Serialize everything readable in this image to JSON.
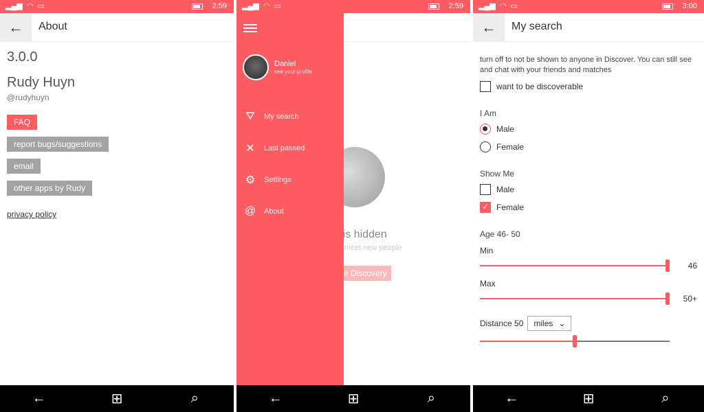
{
  "status": {
    "time_1": "2:59",
    "time_2": "2:59",
    "time_3": "3:00"
  },
  "about": {
    "title": "About",
    "version": "3.0.0",
    "name": "Rudy Huyn",
    "handle": "@rudyhuyn",
    "buttons": {
      "faq": "FAQ",
      "report": "report bugs/suggestions",
      "email": "email",
      "other": "other apps by Rudy"
    },
    "privacy": "privacy policy"
  },
  "drawer": {
    "profile_name": "Daniel",
    "profile_sub": "see your profile",
    "items": [
      {
        "label": "My search",
        "icon": "filter-icon"
      },
      {
        "label": "Last passed",
        "icon": "cross-icon"
      },
      {
        "label": "Settings",
        "icon": "gear-icon"
      },
      {
        "label": "About",
        "icon": "at-icon"
      }
    ],
    "bg_hidden": "rd is hidden",
    "bg_sub": "v to meet new people",
    "bg_button": "e Discovery"
  },
  "search": {
    "title": "My search",
    "intro": "turn off to not be shown to anyone in Discover. You can still see and chat with your friends and matches",
    "discoverable": "want to be discoverable",
    "i_am": "I Am",
    "male": "Male",
    "female": "Female",
    "show_me": "Show Me",
    "age": "Age 46- 50",
    "min": "Min",
    "min_value": "46",
    "max": "Max",
    "max_value": "50+",
    "distance_label": "Distance 50",
    "distance_unit": "miles",
    "discoverable_checked": false,
    "i_am_selected": "male",
    "show_me_male": false,
    "show_me_female": true,
    "distance_fraction": 0.5
  },
  "colors": {
    "accent": "#fd5c63",
    "nav": "#000000"
  }
}
